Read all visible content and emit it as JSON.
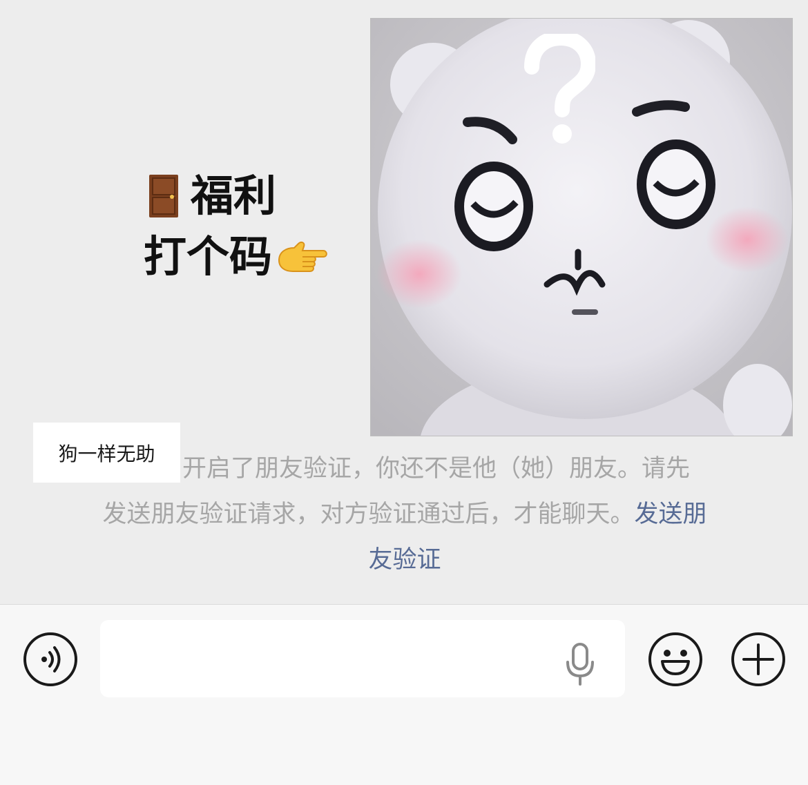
{
  "photo": {
    "caption": {
      "line1": "福利",
      "line2": "打个码"
    },
    "icons": [
      "door-icon",
      "pointing-hand-icon",
      "question-mark-icon"
    ]
  },
  "sender": {
    "name": "狗一样无助"
  },
  "system_notice": {
    "line1": "开启了朋友验证，你还不是他（她）朋友。请先",
    "line2": "发送朋友验证请求，对方验证通过后，才能聊天。",
    "link_part1": "发送朋",
    "link_part2": "友验证"
  },
  "input_bar": {
    "message_value": "",
    "icons": [
      "voice-icon",
      "microphone-icon",
      "emoji-icon",
      "plus-icon"
    ]
  },
  "colors": {
    "chat_background": "#ededed",
    "input_bar_background": "#f7f7f7",
    "link": "#576b95",
    "notice_text": "#a6a6a6"
  }
}
